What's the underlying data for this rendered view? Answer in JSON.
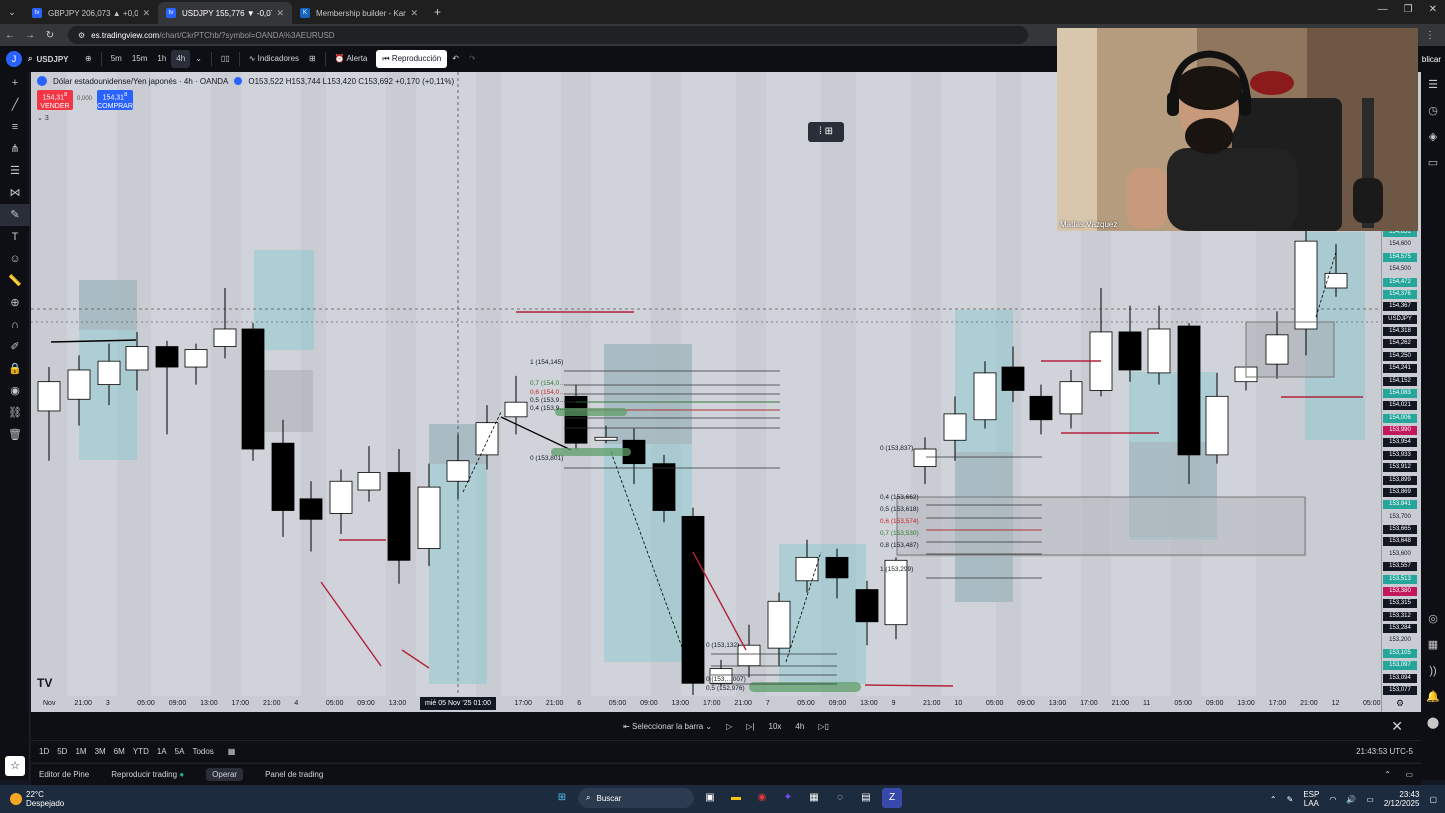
{
  "browser": {
    "tabs": [
      {
        "label": "GBPJPY 206,073 ▲ +0,05% Mar",
        "active": false
      },
      {
        "label": "USDJPY 155,776 ▼ -0,07% Mar",
        "active": true
      },
      {
        "label": "Membership builder - Kartra",
        "active": false
      }
    ],
    "url_host": "es.tradingview.com",
    "url_path": "/chart/CkrPTChb/?symbol=OANDA%3AEURUSD"
  },
  "toolbar": {
    "avatar": "J",
    "symbol": "USDJPY",
    "intervals": [
      "5m",
      "15m",
      "1h",
      "4h"
    ],
    "selected_interval": "4h",
    "indicators": "Indicadores",
    "alert": "Alerta",
    "replay": "Reproducción",
    "publish": "blicar"
  },
  "legend": {
    "title": "Dólar estadounidense/Yen japonés · 4h · OANDA",
    "ohlc": "O153,522 H153,744 L153,420 C153,692 +0,170 (+0,11%)",
    "sell_price": "154,31",
    "sell_sup": "8",
    "sell_label": "VENDER",
    "buy_price": "154,31",
    "buy_sup": "8",
    "buy_label": "COMPRAR",
    "spread": "0,000",
    "collapse": "3"
  },
  "fib_left": {
    "levels": [
      "1 (154,145)",
      "0,7 (154,0…",
      "0,6 (154,0…",
      "0,5 (153,9…",
      "0,4 (153,9…",
      "0 (153,801)"
    ]
  },
  "fib_right": {
    "levels": [
      "0 (153,837)",
      "0,4 (153,662)",
      "0,5 (153,618)",
      "0,6 (153,574)",
      "0,7 (153,530)",
      "0,8 (153,487)",
      "1 (153,299)"
    ]
  },
  "fib_bottom": {
    "levels": [
      "0 (153,132)",
      "0 (153,…007)",
      "0,5 (152,976)"
    ]
  },
  "price_scale": {
    "labels": [
      {
        "v": "154,631",
        "c": "#26a69a"
      },
      {
        "v": "154,600",
        "c": ""
      },
      {
        "v": "154,575",
        "c": "#26a69a"
      },
      {
        "v": "154,500",
        "c": ""
      },
      {
        "v": "154,472",
        "c": "#26a69a"
      },
      {
        "v": "154,376",
        "c": "#26a69a"
      },
      {
        "v": "154,367",
        "c": "#131722"
      },
      {
        "v": "USDJPY",
        "c": "#131722"
      },
      {
        "v": "154,318",
        "c": "#131722"
      },
      {
        "v": "154,262",
        "c": "#131722"
      },
      {
        "v": "154,250",
        "c": "#131722"
      },
      {
        "v": "154,241",
        "c": "#131722"
      },
      {
        "v": "154,152",
        "c": "#131722"
      },
      {
        "v": "154,083",
        "c": "#26a69a"
      },
      {
        "v": "154,021",
        "c": "#131722"
      },
      {
        "v": "154,006",
        "c": "#26a69a"
      },
      {
        "v": "153,990",
        "c": "#c2185b"
      },
      {
        "v": "153,954",
        "c": "#131722"
      },
      {
        "v": "153,933",
        "c": "#131722"
      },
      {
        "v": "153,912",
        "c": "#131722"
      },
      {
        "v": "153,899",
        "c": "#131722"
      },
      {
        "v": "153,869",
        "c": "#131722"
      },
      {
        "v": "153,841",
        "c": "#26a69a"
      },
      {
        "v": "153,700",
        "c": ""
      },
      {
        "v": "153,665",
        "c": "#131722"
      },
      {
        "v": "153,648",
        "c": "#131722"
      },
      {
        "v": "153,600",
        "c": ""
      },
      {
        "v": "153,557",
        "c": "#131722"
      },
      {
        "v": "153,513",
        "c": "#26a69a"
      },
      {
        "v": "153,380",
        "c": "#c2185b"
      },
      {
        "v": "153,315",
        "c": "#131722"
      },
      {
        "v": "153,312",
        "c": "#131722"
      },
      {
        "v": "153,284",
        "c": "#131722"
      },
      {
        "v": "153,200",
        "c": ""
      },
      {
        "v": "153,105",
        "c": "#26a69a"
      },
      {
        "v": "153,097",
        "c": "#26a69a"
      },
      {
        "v": "153,094",
        "c": "#131722"
      },
      {
        "v": "153,077",
        "c": "#131722"
      }
    ]
  },
  "time_scale": {
    "labels": [
      "Nov",
      "21:00",
      "3",
      "05:00",
      "09:00",
      "13:00",
      "17:00",
      "21:00",
      "4",
      "05:00",
      "09:00",
      "13:00",
      "17:00",
      "09:00",
      "13:00",
      "17:00",
      "21:00",
      "6",
      "05:00",
      "09:00",
      "13:00",
      "17:00",
      "21:00",
      "7",
      "05:00",
      "09:00",
      "13:00",
      "9",
      "21:00",
      "10",
      "05:00",
      "09:00",
      "13:00",
      "17:00",
      "21:00",
      "11",
      "05:00",
      "09:00",
      "13:00",
      "17:00",
      "21:00",
      "12",
      "05:00"
    ],
    "cursor": "mié 05 Nov '25   01:00"
  },
  "replay_bar": {
    "select_bar": "Seleccionar la barra",
    "speed": "10x",
    "interval": "4h"
  },
  "periods": {
    "items": [
      "1D",
      "5D",
      "1M",
      "3M",
      "6M",
      "YTD",
      "1A",
      "5A",
      "Todos"
    ],
    "clock": "21:43:53 UTC-5"
  },
  "bottom_tabs": {
    "items": [
      "Editor de Pine",
      "Reproducir trading",
      "Operar",
      "Panel de trading"
    ],
    "active": "Operar"
  },
  "webcam": {
    "name": "Matías Vázquez"
  },
  "taskbar": {
    "temp": "22°C",
    "weather": "Despejado",
    "search": "Buscar",
    "lang1": "ESP",
    "lang2": "LAA",
    "time": "23:43",
    "date": "2/12/2025"
  },
  "colors": {
    "chart_bg": "#c9ccd3",
    "bull": "#ffffff",
    "bear": "#000000",
    "zone_blue": "#8ec9cf",
    "zone_gray": "#a9adb5",
    "red_line": "#b2223a",
    "green_band": "#5e9f6a"
  }
}
